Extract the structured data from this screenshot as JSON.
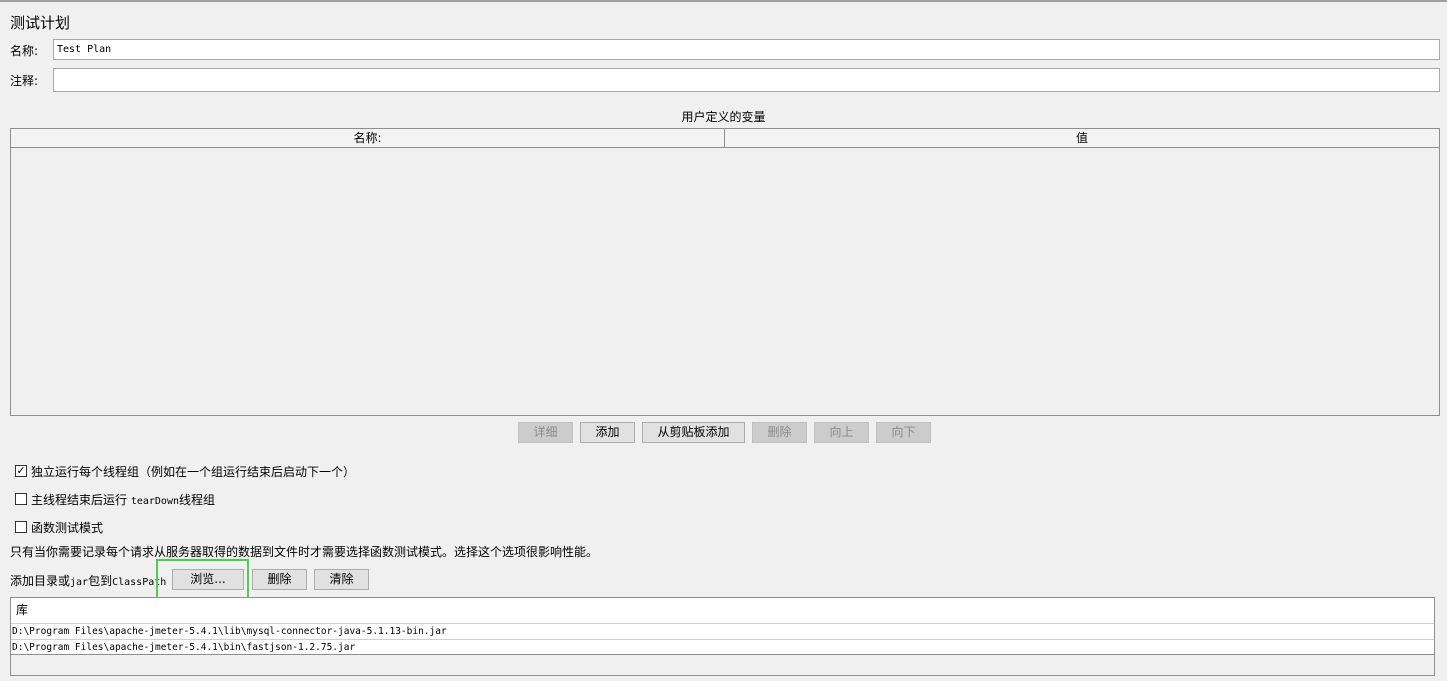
{
  "panel": {
    "title": "测试计划",
    "name_label": "名称:",
    "name_value": "Test Plan",
    "comment_label": "注释:",
    "comment_value": ""
  },
  "variables": {
    "caption": "用户定义的变量",
    "columns": [
      "名称:",
      "值"
    ],
    "rows": []
  },
  "variable_buttons": {
    "detail": "详细",
    "add": "添加",
    "add_from_clipboard": "从剪贴板添加",
    "delete": "删除",
    "up": "向上",
    "down": "向下"
  },
  "options": {
    "run_groups_independently": {
      "label": "独立运行每个线程组（例如在一个组运行结束后启动下一个）",
      "checked": true
    },
    "teardown_after_shutdown_prefix": "主线程结束后运行 ",
    "teardown_after_shutdown_mono": "tearDown",
    "teardown_after_shutdown_suffix": "线程组",
    "teardown_checked": false,
    "functional_mode": {
      "label": "函数测试模式",
      "checked": false
    },
    "functional_note": "只有当你需要记录每个请求从服务器取得的数据到文件时才需要选择函数测试模式。选择这个选项很影响性能。"
  },
  "classpath": {
    "label_prefix": "添加目录或",
    "label_jar": "jar",
    "label_mid": "包到",
    "label_classpath": "ClassPath",
    "browse": "浏览...",
    "delete": "删除",
    "clear": "清除",
    "library_header": "库",
    "libraries": [
      "D:\\Program Files\\apache-jmeter-5.4.1\\lib\\mysql-connector-java-5.1.13-bin.jar",
      "D:\\Program Files\\apache-jmeter-5.4.1\\bin\\fastjson-1.2.75.jar"
    ]
  },
  "colors": {
    "background": "#f0f0f0",
    "highlight": "#4fcf4f"
  }
}
